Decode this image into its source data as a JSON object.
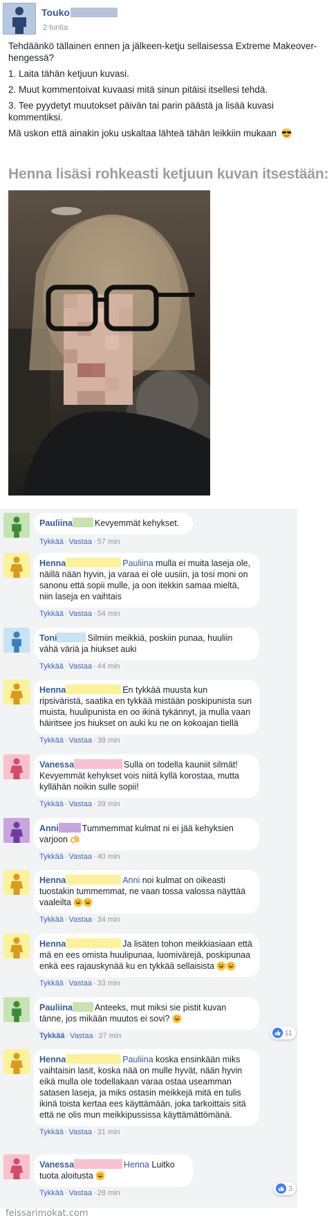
{
  "colors": {
    "link_blue": "#365899",
    "meta_gray": "#90949c",
    "comment_bg": "#f2f3f5",
    "avatar_green": "#c7e3b4",
    "avatar_yellow": "#fcf29b",
    "avatar_blue": "#c9e2f4",
    "avatar_pink": "#f8c1cf",
    "avatar_purple": "#c7a6e0"
  },
  "post": {
    "author": "Touko",
    "time": "2 tuntia",
    "paragraphs": [
      "Tehdäänkö tällainen ennen ja jälkeen-ketju sellaisessa Extreme Makeover-hengessä?",
      "1. Laita tähän ketjuun kuvasi.",
      "2. Muut kommentoivat kuvaasi mitä sinun pitäisi itsellesi tehdä.",
      "3. Tee pyydetyt muutokset päivän tai parin päästä ja lisää kuvasi kommentiksi.",
      "Mä uskon että ainakin joku uskaltaa lähteä tähän leikkiin mukaan"
    ],
    "emoji_icon": "sunglasses-emoji-icon"
  },
  "overlay_caption": "Henna lisäsi rohkeasti ketjuun kuvan itsestään:",
  "photo": {
    "icon": "blurred-selfie-photo"
  },
  "actions": {
    "like": "Tykkää",
    "reply": "Vastaa",
    "separator": "·"
  },
  "comments": [
    {
      "author": "Pauliina",
      "mention": "",
      "text": "Kevyemmät kehykset.",
      "time": "57 min",
      "avatar": "green",
      "reactions": ""
    },
    {
      "author": "Henna",
      "mention": "Pauliina",
      "text": "mulla ei muita laseja ole, näillä nään hyvin, ja varaa ei ole uusiin, ja tosi moni on sanonu että sopii mulle, ja oon itekkin samaa mieltä, niin laseja en vaihtais",
      "time": "54 min",
      "avatar": "yellow",
      "reactions": ""
    },
    {
      "author": "Toni",
      "mention": "",
      "text": "Silmiin meikkiä, poskiin punaa, huuliin vähä väriä ja hiukset auki",
      "time": "44 min",
      "avatar": "blue",
      "reactions": ""
    },
    {
      "author": "Henna",
      "mention": "",
      "text": "En tykkää muusta kun ripsiväristä, saatika en tykkää mistään poskipunista sun muista, huulipunista en oo ikinä tykännyt, ja mulla vaan häiritsee jos hiukset on auki ku ne on kokoajan tiellä",
      "time": "38 min",
      "avatar": "yellow",
      "reactions": ""
    },
    {
      "author": "Vanessa",
      "mention": "",
      "text": "Sulla on todella kauniit silmät! Kevyemmät kehykset vois niitä kyllä korostaa, mutta kyllähän noikin sulle sopii!",
      "time": "39 min",
      "avatar": "pink",
      "reactions": ""
    },
    {
      "author": "Anni",
      "mention": "",
      "text": "Tummemmat kulmat ni ei jää kehyksien varjoon",
      "time": "40 min",
      "avatar": "purple",
      "reactions": ""
    },
    {
      "author": "Henna",
      "mention": "Anni",
      "text": "noi kulmat on oikeasti tuostakin tummemmat, ne vaan tossa valossa näyttää vaaleilta",
      "time": "34 min",
      "avatar": "yellow",
      "reactions": ""
    },
    {
      "author": "Henna",
      "mention": "",
      "text": "Ja lisäten tohon meikkiasiaan että mä en ees omista huulipunaa, luomivärejä, poskipunaa enkä ees rajauskynää ku en tykkää sellaisista",
      "time": "33 min",
      "avatar": "yellow",
      "reactions": ""
    },
    {
      "author": "Pauliina",
      "mention": "",
      "text": "Anteeks, mut miksi sie pistit kuvan tänne, jos mikään muutos ei sovi?",
      "time": "37 min",
      "avatar": "green",
      "reactions": "11"
    },
    {
      "author": "Henna",
      "mention": "Pauliina",
      "text": "koska ensinkään miks vaihtaisin lasit, koska nää on mulle hyvät, nään hyvin eikä mulla ole todellakaan varaa ostaa useamman satasen laseja, ja miks ostasin meikkejä mitä en tulis ikinä toista kertaa ees käyttämään, joka tarkoittais sitä että ne olis mun meikkipussissa käyttämättömänä.",
      "time": "31 min",
      "avatar": "yellow",
      "reactions": ""
    },
    {
      "author": "Vanessa",
      "mention": "Henna",
      "text": "Luitko tuota aloitusta",
      "time": "28 min",
      "avatar": "pink",
      "reactions": "3"
    }
  ],
  "watermark": "feissarimokat.com"
}
